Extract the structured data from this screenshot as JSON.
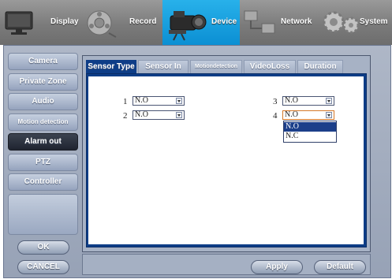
{
  "top_nav": {
    "items": [
      {
        "label": "Display",
        "icon": "monitor-icon"
      },
      {
        "label": "Record",
        "icon": "reel-icon"
      },
      {
        "label": "Device",
        "icon": "camcorder-icon",
        "active": true
      },
      {
        "label": "Network",
        "icon": "network-icon"
      },
      {
        "label": "System",
        "icon": "gears-icon"
      }
    ]
  },
  "sidebar": {
    "items": [
      {
        "label": "Camera"
      },
      {
        "label": "Private Zone"
      },
      {
        "label": "Audio"
      },
      {
        "label": "Motion detection"
      },
      {
        "label": "Alarm out",
        "active": true
      },
      {
        "label": "PTZ"
      },
      {
        "label": "Controller"
      }
    ],
    "ok_label": "OK",
    "cancel_label": "CANCEL"
  },
  "tabs": [
    {
      "label": "Sensor Type",
      "active": true
    },
    {
      "label": "Sensor In"
    },
    {
      "label": "Motiondetection"
    },
    {
      "label": "VideoLoss"
    },
    {
      "label": "Duration"
    }
  ],
  "sensors": [
    {
      "number": "1",
      "value": "N.O"
    },
    {
      "number": "2",
      "value": "N.O"
    },
    {
      "number": "3",
      "value": "N.O"
    },
    {
      "number": "4",
      "value": "N.O"
    }
  ],
  "dropdown": {
    "options": [
      "N.O",
      "N.C"
    ],
    "highlighted": "N.O"
  },
  "footer": {
    "apply_label": "Apply",
    "default_label": "Default"
  },
  "colors": {
    "active_nav": "#1ba3e3",
    "active_sidebar": "#2b303b",
    "tab_active": "#0e3d87",
    "panel": "#a7b2c5"
  }
}
